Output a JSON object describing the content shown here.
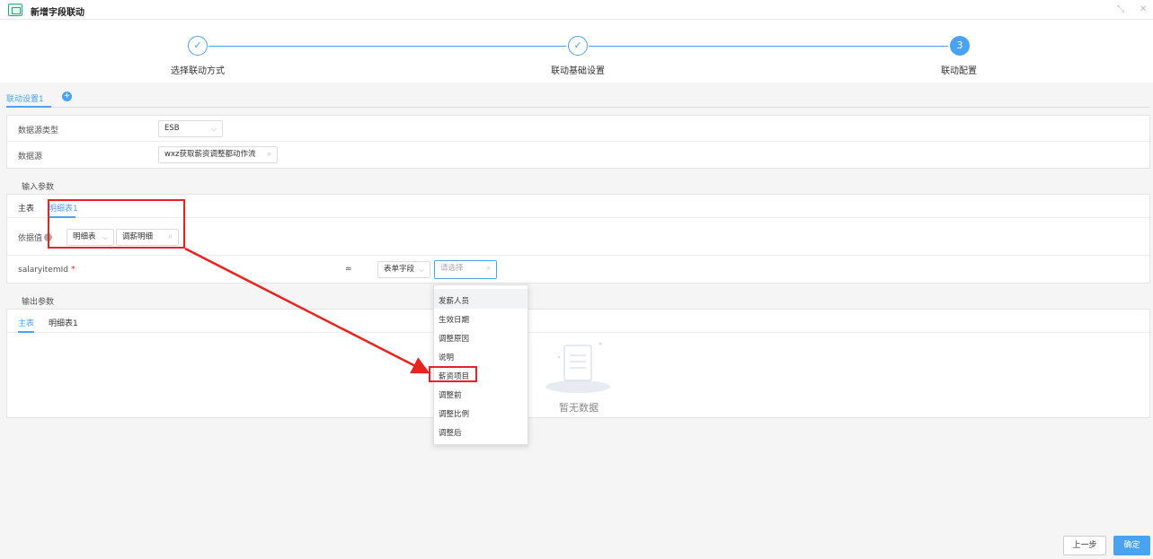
{
  "window": {
    "title": "新增字段联动",
    "icon": "table-icon",
    "minimize": "⤡",
    "close": "✕"
  },
  "steps": [
    {
      "label": "选择联动方式",
      "status": "done"
    },
    {
      "label": "联动基础设置",
      "status": "done"
    },
    {
      "label": "联动配置",
      "status": "active",
      "number": "3"
    }
  ],
  "link_tabs": {
    "active": "联动设置1",
    "add_icon": "plus-icon"
  },
  "datasource": {
    "type_label": "数据源类型",
    "type_value": "ESB",
    "source_label": "数据源",
    "source_value": "wxz获取薪资调整都动作流"
  },
  "input_params": {
    "title": "输入参数",
    "tabs": [
      "主表",
      "明细表1"
    ],
    "active_tab": "明细表1",
    "basis_label": "依据值",
    "basis_select": "明细表",
    "basis_value": "调薪明细",
    "field_name": "salaryitemId",
    "required_mark": "*",
    "operator": "=",
    "field_type": "表单字段",
    "field_placeholder": "请选择"
  },
  "output_params": {
    "title": "输出参数",
    "tabs": [
      "主表",
      "明细表1"
    ],
    "active_tab": "主表",
    "empty_text": "暂无数据"
  },
  "dropdown": {
    "items": [
      "发薪人员",
      "生效日期",
      "调整原因",
      "说明",
      "薪资项目",
      "调整前",
      "调整比例",
      "调整后"
    ],
    "hovered": "发薪人员",
    "highlighted": "薪资项目"
  },
  "footer": {
    "prev_label": "上一步",
    "ok_label": "确定"
  },
  "colors": {
    "accent": "#4aa3f0",
    "annotation": "#e8231f"
  }
}
